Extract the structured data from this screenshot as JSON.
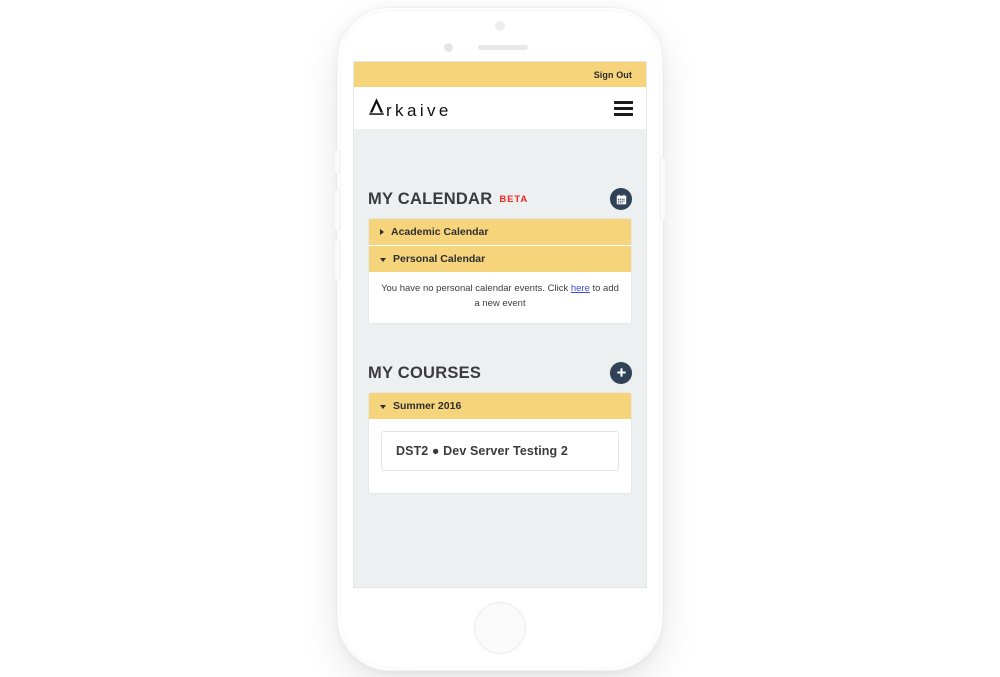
{
  "app": {
    "name": "Arkaive",
    "logo_letter": "A",
    "logo_rest": "rkaive"
  },
  "topbar": {
    "sign_out_label": "Sign Out"
  },
  "header": {
    "menu_icon": "hamburger-menu-icon"
  },
  "calendar_section": {
    "title": "MY CALENDAR",
    "badge": "BETA",
    "action_icon": "calendar-icon",
    "items": [
      {
        "label": "Academic Calendar",
        "expanded": false,
        "caret": "caret-right-icon"
      },
      {
        "label": "Personal Calendar",
        "expanded": true,
        "caret": "caret-down-icon"
      }
    ],
    "empty_message_before": "You have no personal calendar events. Click ",
    "empty_message_link": "here",
    "empty_message_after": " to add a new event"
  },
  "courses_section": {
    "title": "MY COURSES",
    "action_icon": "plus-icon",
    "terms": [
      {
        "label": "Summer 2016",
        "expanded": true,
        "caret": "caret-down-icon",
        "courses": [
          {
            "code": "DST2",
            "separator": "●",
            "name": "Dev Server Testing 2",
            "full": "DST2 ● Dev Server Testing 2"
          }
        ]
      }
    ]
  },
  "colors": {
    "accent_yellow": "#f6d47c",
    "dark_navy": "#2f4257",
    "beta_red": "#ee2a22",
    "link_blue": "#3b4ce0",
    "screen_bg": "#edf0f1"
  }
}
